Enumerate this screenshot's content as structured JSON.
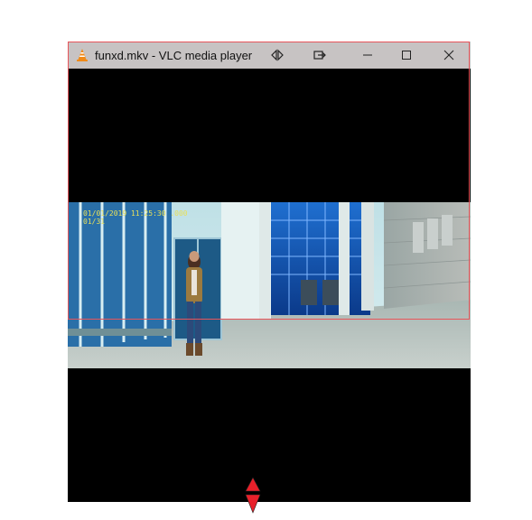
{
  "window": {
    "title": "funxd.mkv - VLC media player",
    "app_icon": "vlc-cone-icon",
    "buttons": {
      "snap": "snap-layout-icon",
      "popout": "popout-icon",
      "minimize": "minimize-icon",
      "maximize": "maximize-icon",
      "close": "close-icon"
    }
  },
  "video": {
    "overlay_line1": "01/01/2019 11:25:30 .000",
    "overlay_line2": "01/31"
  },
  "colors": {
    "titlebar": "#c7c3c3",
    "selection": "#e8555a",
    "handle": "#e8202a"
  }
}
